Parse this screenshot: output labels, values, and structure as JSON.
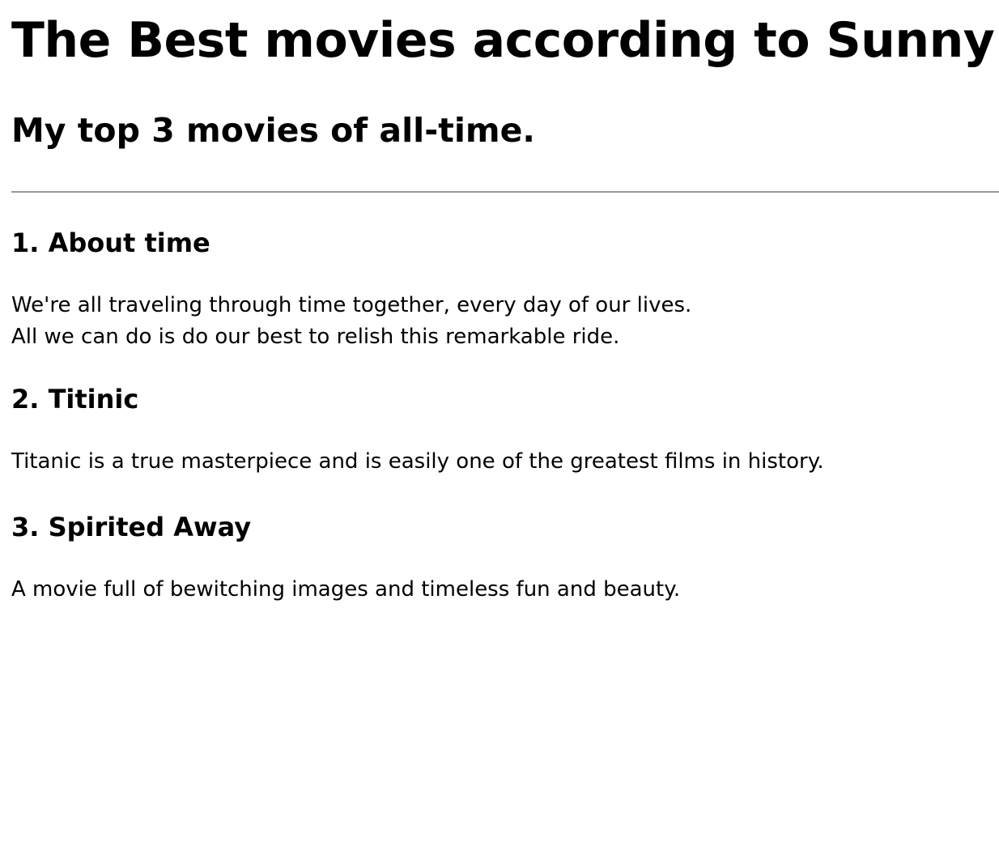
{
  "page": {
    "title": "The Best movies according to Sunny",
    "subtitle": "My top 3 movies of all-time."
  },
  "movies": [
    {
      "heading": "1. About time",
      "lines": [
        "We're all traveling through time together, every day of our lives.",
        "All we can do is do our best to relish this remarkable ride."
      ]
    },
    {
      "heading": "2. Titinic",
      "lines": [
        "Titanic is a true masterpiece and is easily one of the greatest films in history."
      ]
    },
    {
      "heading": "3. Spirited Away",
      "lines": [
        "A movie full of bewitching images and timeless fun and beauty."
      ]
    }
  ]
}
